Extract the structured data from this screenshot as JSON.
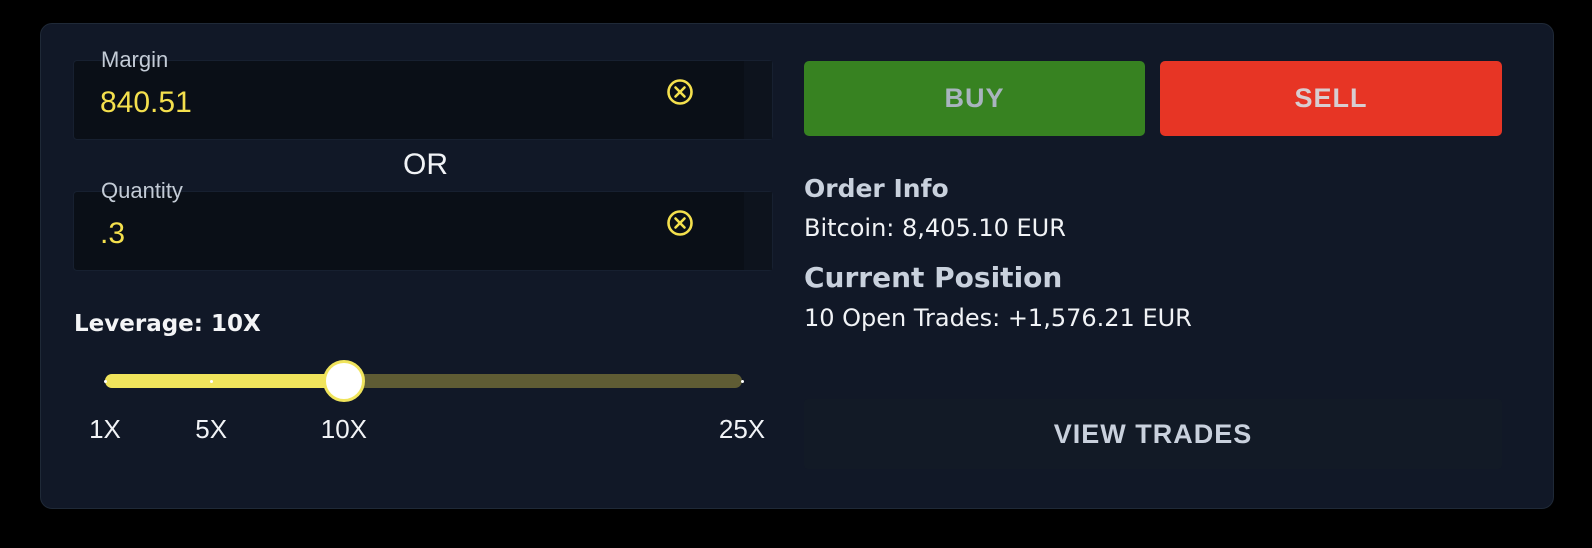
{
  "margin": {
    "label": "Margin",
    "value": "840.51",
    "clear_icon": "clear-circle-x-icon"
  },
  "separator": "OR",
  "quantity": {
    "label": "Quantity",
    "value": ".3",
    "clear_icon": "clear-circle-x-icon"
  },
  "leverage": {
    "label": "Leverage: 10X",
    "selected": "10X",
    "min": 1,
    "max": 25,
    "value": 10,
    "ticks": [
      "1X",
      "5X",
      "10X",
      "25X"
    ],
    "tick_values": [
      1,
      5,
      10,
      25
    ]
  },
  "actions": {
    "buy_label": "BUY",
    "sell_label": "SELL",
    "view_trades_label": "VIEW TRADES"
  },
  "order_info": {
    "heading": "Order Info",
    "line": "Bitcoin: 8,405.10 EUR"
  },
  "current_position": {
    "heading": "Current Position",
    "line": "10 Open Trades: +1,576.21 EUR"
  },
  "colors": {
    "panel_bg": "#111827",
    "accent_yellow": "#f4e04d",
    "buy_green": "#378221",
    "sell_red": "#e73525"
  }
}
